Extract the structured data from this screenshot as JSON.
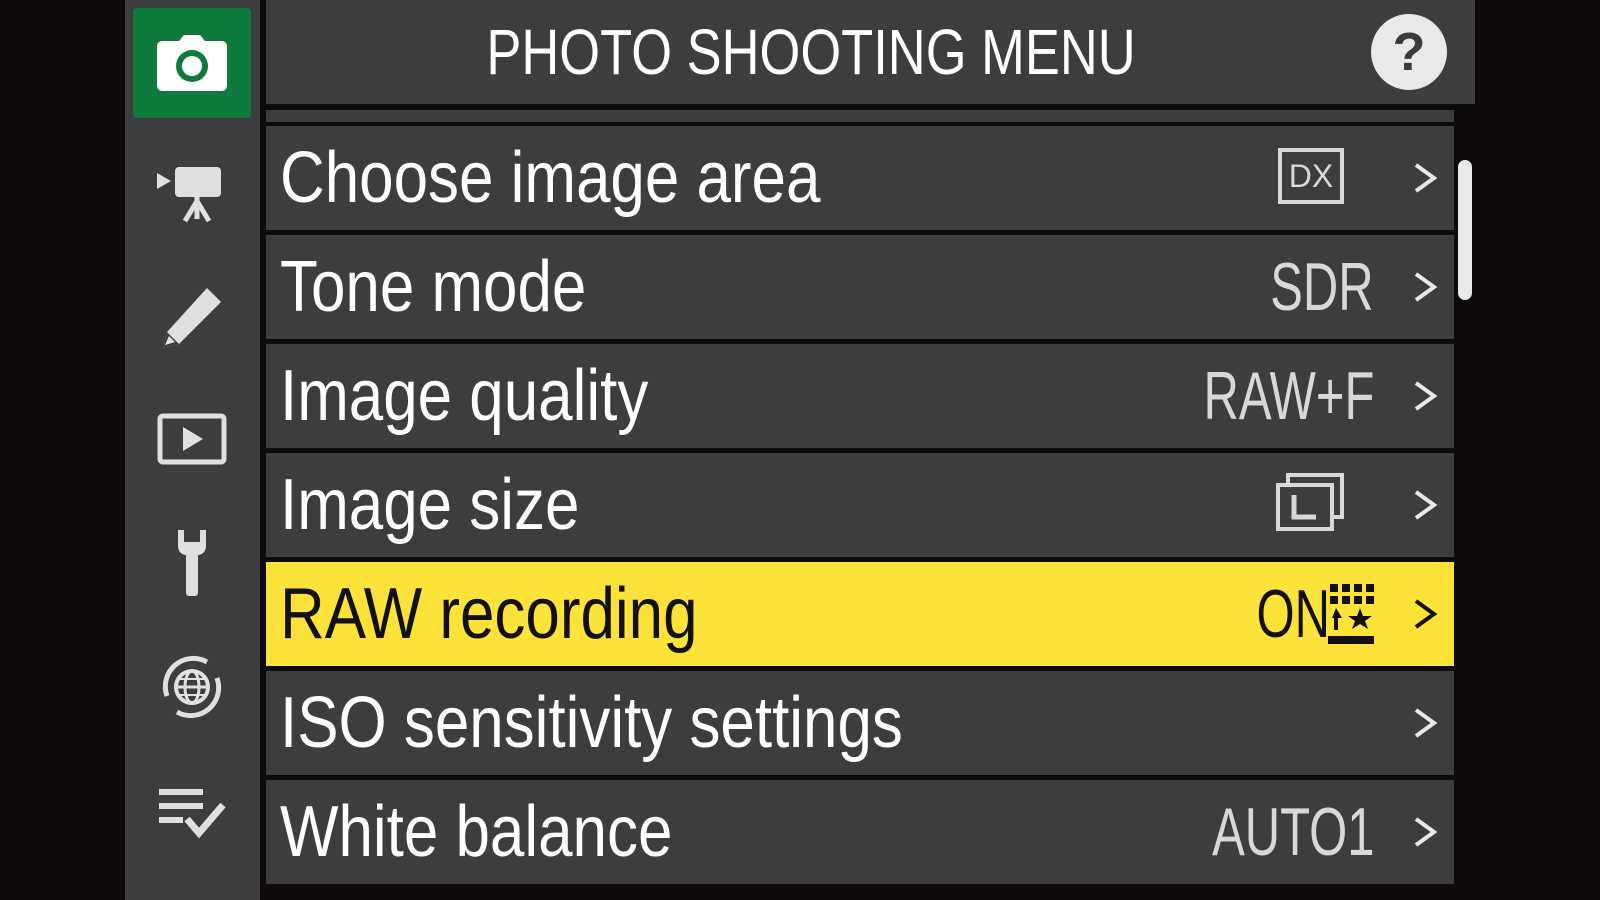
{
  "header": {
    "title": "PHOTO SHOOTING MENU",
    "help_label": "?"
  },
  "sidebar": {
    "items": [
      {
        "icon": "camera-icon",
        "active": true
      },
      {
        "icon": "video-camera-icon",
        "active": false
      },
      {
        "icon": "pencil-icon",
        "active": false
      },
      {
        "icon": "playback-icon",
        "active": false
      },
      {
        "icon": "wrench-icon",
        "active": false
      },
      {
        "icon": "network-globe-icon",
        "active": false
      },
      {
        "icon": "my-menu-checklist-icon",
        "active": false
      }
    ]
  },
  "menu": {
    "items": [
      {
        "label": "Choose image area",
        "value": "DX",
        "value_type": "boxed"
      },
      {
        "label": "Tone mode",
        "value": "SDR",
        "value_type": "text"
      },
      {
        "label": "Image quality",
        "value": "RAW+F",
        "value_type": "text"
      },
      {
        "label": "Image size",
        "value": "",
        "value_type": "size-icon"
      },
      {
        "label": "RAW recording",
        "value": "ON",
        "value_type": "text-icon",
        "selected": true
      },
      {
        "label": "ISO sensitivity settings",
        "value": "",
        "value_type": "none"
      },
      {
        "label": "White balance",
        "value": "AUTO1",
        "value_type": "text"
      }
    ]
  },
  "colors": {
    "background": "#0d090c",
    "panel": "#3d3d3f",
    "active_tab": "#0e7a3c",
    "selected_row": "#fde23a",
    "text": "#ffffff"
  },
  "scrollbar": {
    "position_fraction": 0.0,
    "visible_fraction": 0.19
  }
}
